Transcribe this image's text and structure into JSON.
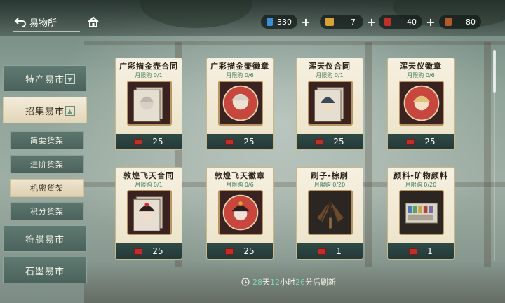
{
  "header": {
    "title": "易物所",
    "back_icon": "back-arrow-icon",
    "home_icon": "home-icon"
  },
  "resources": [
    {
      "name": "blue-ticket-icon",
      "value": "330",
      "color": "#3b8fd8"
    },
    {
      "name": "gold-coin-icon",
      "value": "7",
      "color": "#d8a23b"
    },
    {
      "name": "red-ticket-icon",
      "value": "40",
      "color": "#c0302a"
    },
    {
      "name": "scroll-icon",
      "value": "80",
      "color": "#b45a2a"
    }
  ],
  "sidebar": {
    "tabs": [
      {
        "label": "特产易市",
        "dropdown": "▼"
      },
      {
        "label": "招集易市",
        "dropdown": "▲"
      },
      {
        "label": "符牒易市"
      },
      {
        "label": "石墨易市"
      }
    ],
    "subtabs": [
      {
        "label": "简要货架"
      },
      {
        "label": "进阶货架"
      },
      {
        "label": "机密货架"
      },
      {
        "label": "积分货架"
      }
    ]
  },
  "items": [
    {
      "name": "广彩描金壶合同",
      "limit": "月限购 0/1",
      "price": "25"
    },
    {
      "name": "广彩描金壶徽章",
      "limit": "月限购 0/6",
      "price": "25"
    },
    {
      "name": "浑天仪合同",
      "limit": "月限购 0/1",
      "price": "25"
    },
    {
      "name": "浑天仪徽章",
      "limit": "月限购 0/6",
      "price": "25"
    },
    {
      "name": "敦煌飞天合同",
      "limit": "月限购 0/1",
      "price": "25"
    },
    {
      "name": "敦煌飞天徽章",
      "limit": "月限购 0/6",
      "price": "25"
    },
    {
      "name": "刷子-棕刷",
      "limit": "月限购 0/20",
      "price": "1"
    },
    {
      "name": "颜料-矿物颜料",
      "limit": "月限购 0/20",
      "price": "1"
    }
  ],
  "refresh": {
    "days": "28",
    "days_unit": "天",
    "hours": "12",
    "hours_unit": "小时",
    "minutes": "26",
    "minutes_unit": "分后刷新"
  }
}
